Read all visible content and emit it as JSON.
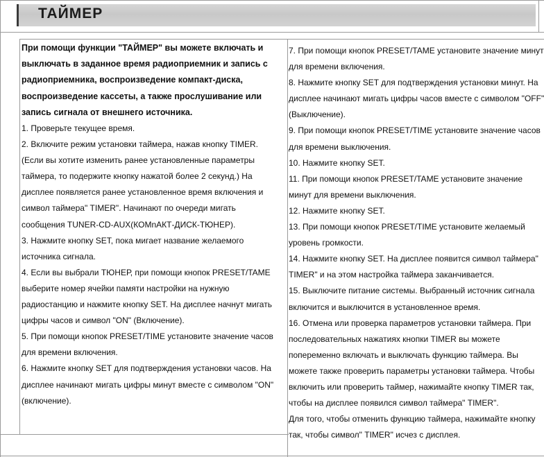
{
  "header": {
    "title": "ТАЙМЕР"
  },
  "left_column": {
    "intro": "При помощи функции \"ТАЙМЕР\" вы можете включать и выключать в заданное время радиоприемник и запись с радиоприемника, воспроизведение компакт-диска, воспроизведение кассеты, а также прослушивание или запись сигнала от внешнего источника.",
    "steps": [
      "1. Проверьте текущее время.",
      "2. Включите режим установки таймера, нажав кнопку TIMER. (Если вы хотите изменить ранее установленные параметры таймера, то подержите кнопку нажатой более 2 секунд.) На дисплее появляется ранее установленное время включения и символ таймера\" TIMER\". Начинают по очереди мигать сообщения TUNER-CD-AUX(КОМnАКТ-ДИСК-ТЮНЕР).",
      "3. Нажмите кнопку SET, пока мигает название желаемого источника сигнала.",
      "4. Если вы выбрали ТЮНЕР, при помощи кнопок PRESET/TAME выберите номер ячейки памяти настройки на нужную радиостанцию и нажмите кнопку SET. На дисплее начнут мигать цифры часов и символ \"ON\" (Включение).",
      "5. При помощи кнопок PRESET/TIME установите значение часов для времени включения.",
      "6. Нажмите кнопку SET для подтверждения установки часов. На дисплее начинают мигать цифры минут вместе с символом \"ON\" (включение)."
    ]
  },
  "right_column": {
    "steps": [
      "7. При помощи кнопок PRESET/TAME установите значение минут для времени включения.",
      "8. Нажмите кнопку SET для подтверждения установки минут. На дисплее начинают мигать цифры часов вместе с символом \"OFF\" (Выключение).",
      "9. При помощи кнопок PRESET/TIME установите значение часов для времени выключения.",
      "10. Нажмите кнопку SET.",
      "11. При помощи кнопок PRESET/TAME установите значение минут для времени выключения.",
      "12. Нажмите кнопку SET.",
      "13. При помощи кнопок PRESET/TIME установите желаемый уровень громкости.",
      "14. Нажмите кнопку SET. На дисплее появится символ таймера\" TIMER\" и на этом настройка таймера заканчивается.",
      "15. Выключите питание системы. Выбранный источник сигнала включится и выключится в установленное время.",
      "16. Отмена или проверка параметров установки таймера. При последовательных нажатиях кнопки TIMER вы можете попеременно включать и выключать функцию таймера. Вы можете также проверить параметры установки таймера. Чтобы включить или проверить таймер, нажимайте кнопку TIMER так, чтобы на дисплее появился символ таймера\" TIMER\".",
      "Для того, чтобы отменить функцию таймера, нажимайте кнопку так, чтобы символ\" TIMER\" исчез с дисплея."
    ]
  }
}
